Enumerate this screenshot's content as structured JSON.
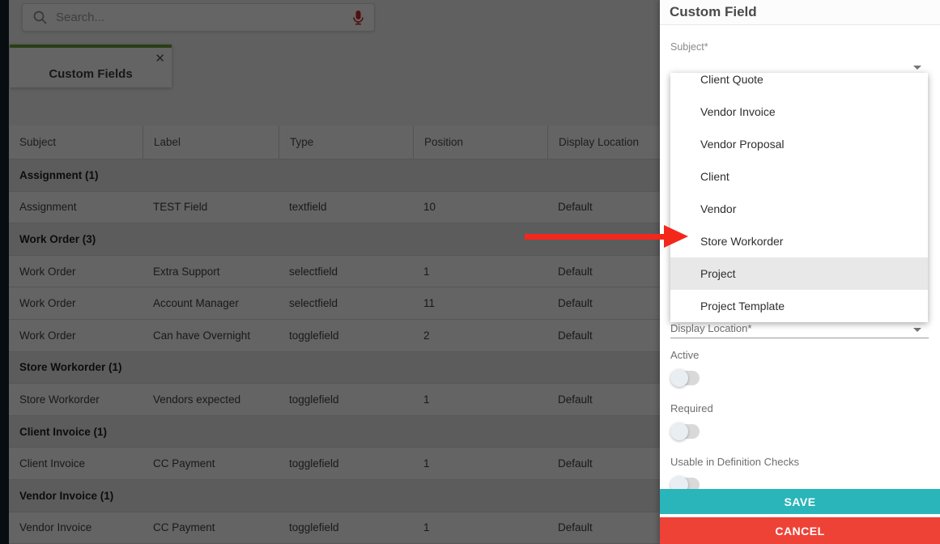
{
  "topbar": {
    "search_placeholder": "Search..."
  },
  "tab": {
    "label": "Custom Fields",
    "close_glyph": "✕"
  },
  "table": {
    "columns": [
      "Subject",
      "Label",
      "Type",
      "Position",
      "Display Location"
    ],
    "rows": [
      {
        "kind": "group",
        "label": "Assignment (1)"
      },
      {
        "kind": "data",
        "cells": [
          "Assignment",
          "TEST Field",
          "textfield",
          "10",
          "Default"
        ]
      },
      {
        "kind": "group",
        "label": "Work Order (3)"
      },
      {
        "kind": "data",
        "cells": [
          "Work Order",
          "Extra Support",
          "selectfield",
          "1",
          "Default"
        ]
      },
      {
        "kind": "data",
        "cells": [
          "Work Order",
          "Account Manager",
          "selectfield",
          "11",
          "Default"
        ]
      },
      {
        "kind": "data",
        "cells": [
          "Work Order",
          "Can have Overnight",
          "togglefield",
          "2",
          "Default"
        ]
      },
      {
        "kind": "group",
        "label": "Store Workorder (1)"
      },
      {
        "kind": "data",
        "cells": [
          "Store Workorder",
          "Vendors expected",
          "togglefield",
          "1",
          "Default"
        ]
      },
      {
        "kind": "group",
        "label": "Client Invoice (1)"
      },
      {
        "kind": "data",
        "cells": [
          "Client Invoice",
          "CC Payment",
          "togglefield",
          "1",
          "Default"
        ]
      },
      {
        "kind": "group",
        "label": "Vendor Invoice (1)"
      },
      {
        "kind": "data",
        "cells": [
          "Vendor Invoice",
          "CC Payment",
          "togglefield",
          "1",
          "Default"
        ]
      }
    ]
  },
  "panel": {
    "title": "Custom Field",
    "subject_label": "Subject*",
    "display_location_label": "Display Location*",
    "active_label": "Active",
    "required_label": "Required",
    "usable_label": "Usable in Definition Checks",
    "save_label": "SAVE",
    "cancel_label": "CANCEL",
    "toggles": {
      "active": "off",
      "required": "off",
      "usable": "off"
    }
  },
  "dropdown": {
    "items": [
      "Client Quote",
      "Vendor Invoice",
      "Vendor Proposal",
      "Client",
      "Vendor",
      "Store Workorder",
      "Project",
      "Project Template"
    ],
    "highlighted_item": "Project"
  },
  "annotation": {
    "arrow_points_to": "Store Workorder"
  },
  "colors": {
    "save_teal": "#29b5ba",
    "cancel_red": "#ee4237",
    "arrow_red": "#f4271b",
    "tab_green": "#689f38",
    "sidebar_navy": "#16222c",
    "mic_red": "#c62828"
  }
}
